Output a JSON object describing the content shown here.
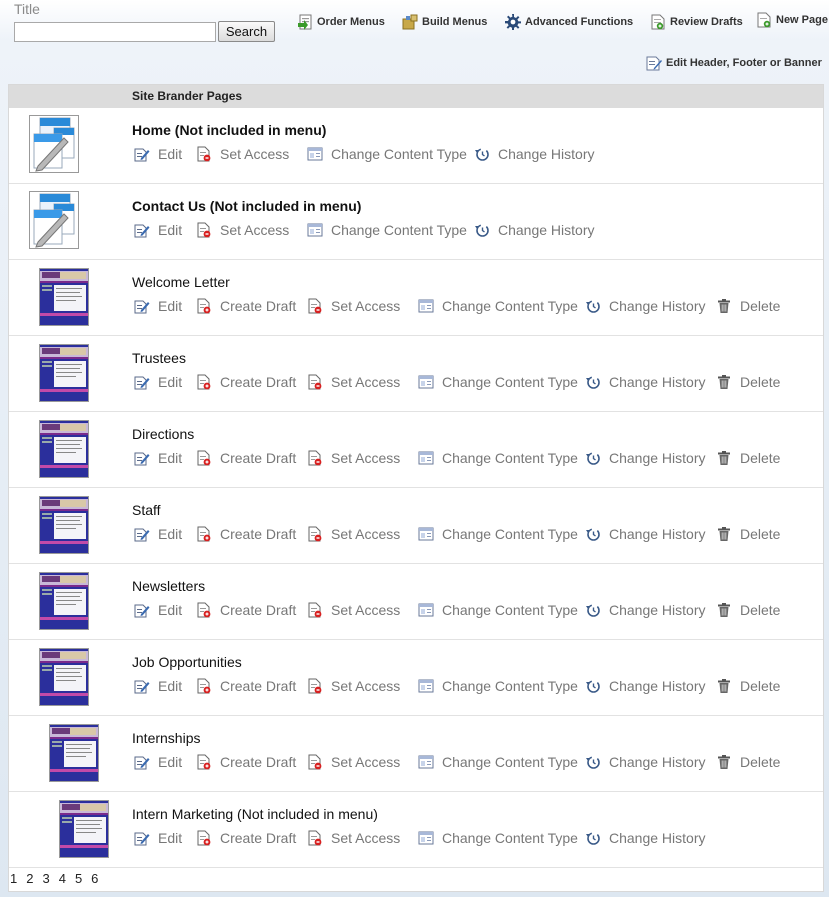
{
  "search": {
    "label": "Title",
    "value": "",
    "button": "Search"
  },
  "toolbar": {
    "order_menus": "Order Menus",
    "build_menus": "Build Menus",
    "advanced_functions": "Advanced Functions",
    "review_drafts": "Review Drafts",
    "new_page": "New Page",
    "edit_header": "Edit Header, Footer or Banner"
  },
  "table": {
    "header": "Site Brander Pages"
  },
  "pages": [
    {
      "title": "Home (Not included in menu)",
      "bold": true,
      "thumb": "icon",
      "actions": [
        "Edit",
        "Set Access",
        "Change Content Type",
        "Change History"
      ]
    },
    {
      "title": "Contact Us (Not included in menu)",
      "bold": true,
      "thumb": "icon",
      "actions": [
        "Edit",
        "Set Access",
        "Change Content Type",
        "Change History"
      ]
    },
    {
      "title": "Welcome Letter",
      "bold": false,
      "thumb": "screenshot",
      "actions": [
        "Edit",
        "Create Draft",
        "Set Access",
        "Change Content Type",
        "Change History",
        "Delete"
      ]
    },
    {
      "title": "Trustees",
      "bold": false,
      "thumb": "screenshot",
      "actions": [
        "Edit",
        "Create Draft",
        "Set Access",
        "Change Content Type",
        "Change History",
        "Delete"
      ]
    },
    {
      "title": "Directions",
      "bold": false,
      "thumb": "screenshot",
      "actions": [
        "Edit",
        "Create Draft",
        "Set Access",
        "Change Content Type",
        "Change History",
        "Delete"
      ]
    },
    {
      "title": "Staff",
      "bold": false,
      "thumb": "screenshot",
      "actions": [
        "Edit",
        "Create Draft",
        "Set Access",
        "Change Content Type",
        "Change History",
        "Delete"
      ]
    },
    {
      "title": "Newsletters",
      "bold": false,
      "thumb": "screenshot",
      "actions": [
        "Edit",
        "Create Draft",
        "Set Access",
        "Change Content Type",
        "Change History",
        "Delete"
      ]
    },
    {
      "title": "Job Opportunities",
      "bold": false,
      "thumb": "screenshot",
      "actions": [
        "Edit",
        "Create Draft",
        "Set Access",
        "Change Content Type",
        "Change History",
        "Delete"
      ]
    },
    {
      "title": "Internships",
      "bold": false,
      "thumb": "screenshot",
      "actions": [
        "Edit",
        "Create Draft",
        "Set Access",
        "Change Content Type",
        "Change History",
        "Delete"
      ]
    },
    {
      "title": "Intern Marketing (Not included in menu)",
      "bold": false,
      "thumb": "screenshot",
      "actions": [
        "Edit",
        "Create Draft",
        "Set Access",
        "Change Content Type",
        "Change History"
      ]
    }
  ],
  "pagination": [
    "1",
    "2",
    "3",
    "4",
    "5",
    "6"
  ],
  "colors": {
    "header_bg": "#dcdcdc",
    "action_text": "#777777",
    "thumb_blue": "#2b2f9c",
    "thumb_purple": "#7a2a8c"
  }
}
